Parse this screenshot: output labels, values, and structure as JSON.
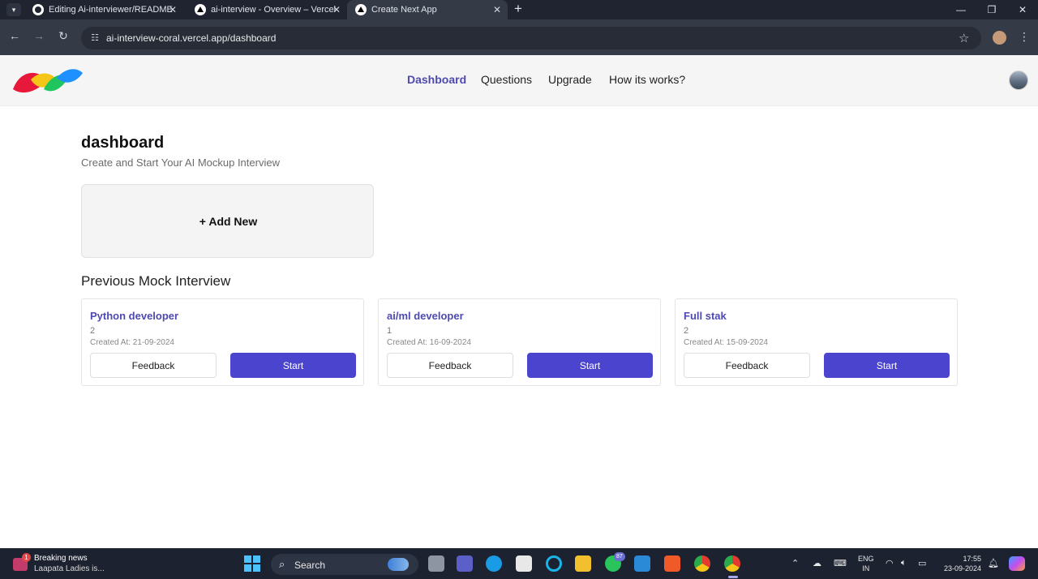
{
  "browser": {
    "tabs": [
      {
        "title": "Editing Ai-interviewer/README",
        "favicon": "github-icon"
      },
      {
        "title": "ai-interview - Overview – Vercel",
        "favicon": "vercel-icon"
      },
      {
        "title": "Create Next App",
        "favicon": "vercel-icon",
        "active": true
      }
    ],
    "tab_close": "✕",
    "new_tab": "+",
    "url": "ai-interview-coral.vercel.app/dashboard"
  },
  "header": {
    "nav": [
      {
        "label": "Dashboard",
        "active": true
      },
      {
        "label": "Questions",
        "active": false
      },
      {
        "label": "Upgrade",
        "active": false
      },
      {
        "label": "How its works?",
        "active": false
      }
    ]
  },
  "main": {
    "title": "dashboard",
    "subtitle": "Create and Start Your AI Mockup Interview",
    "add_new": "+ Add New",
    "previous_title": "Previous Mock Interview",
    "interviews": [
      {
        "position": "Python developer",
        "experience": "2",
        "created": "Created At: 21-09-2024",
        "feedback": "Feedback",
        "start": "Start"
      },
      {
        "position": "ai/ml developer",
        "experience": "1",
        "created": "Created At: 16-09-2024",
        "feedback": "Feedback",
        "start": "Start"
      },
      {
        "position": "Full stak",
        "experience": "2",
        "created": "Created At: 15-09-2024",
        "feedback": "Feedback",
        "start": "Start"
      }
    ]
  },
  "taskbar": {
    "news_title": "Breaking news",
    "news_sub": "Laapata Ladies is...",
    "news_badge": "1",
    "search_label": "Search",
    "whatsapp_badge": "87",
    "lang_1": "ENG",
    "lang_2": "IN",
    "time": "17:55",
    "date": "23-09-2024"
  },
  "colors": {
    "accent": "#4b44cf",
    "nav_active": "#4e4ab0",
    "tabbar": "#1f2430",
    "taskbar": "#1c2230"
  }
}
